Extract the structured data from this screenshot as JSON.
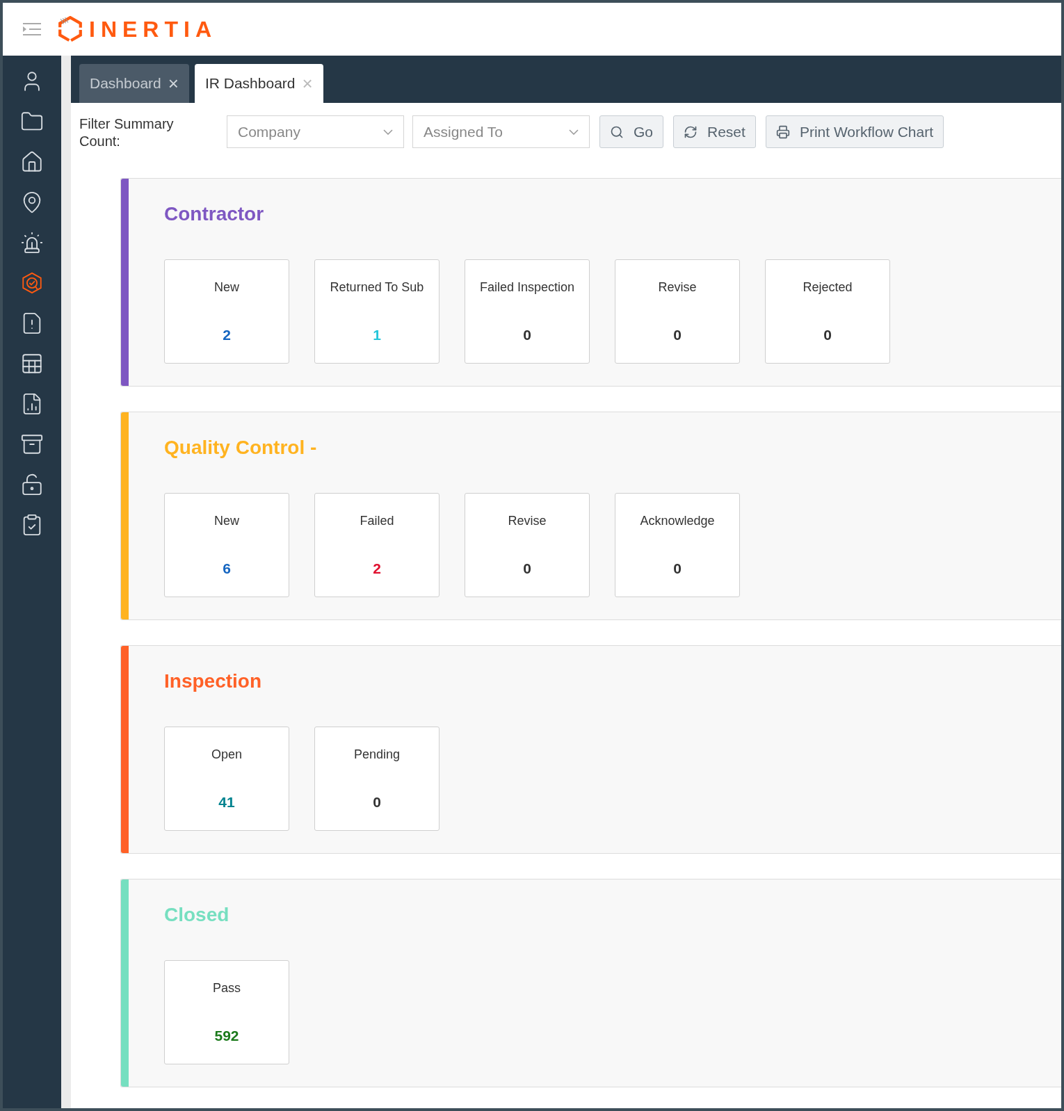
{
  "header": {
    "logo_text": "INERTIA"
  },
  "sidebar": {
    "items": [
      {
        "selected": false
      },
      {
        "selected": false
      },
      {
        "selected": false
      },
      {
        "selected": false
      },
      {
        "selected": false
      },
      {
        "selected": true
      },
      {
        "selected": false
      },
      {
        "selected": false
      },
      {
        "selected": false
      },
      {
        "selected": false
      },
      {
        "selected": false
      },
      {
        "selected": false
      }
    ]
  },
  "tabs": [
    {
      "label": "Dashboard",
      "selected": false,
      "close": "×"
    },
    {
      "label": "IR Dashboard",
      "selected": true,
      "close": "×"
    }
  ],
  "filter": {
    "label": "Filter Summary Count:",
    "company": {
      "placeholder": "Company"
    },
    "assigned_to": {
      "placeholder": "Assigned To"
    },
    "buttons": [
      {
        "kind": "search",
        "label": "Go"
      },
      {
        "kind": "reset",
        "label": "Reset"
      },
      {
        "kind": "print",
        "label": "Print Workflow Chart"
      }
    ]
  },
  "sections": [
    {
      "title": "Contractor",
      "color": "#7e57c2",
      "stats": [
        {
          "label": "New",
          "count": "2",
          "color": "#1565c0"
        },
        {
          "label": "Returned To Sub",
          "count": "1",
          "color": "#26c6da"
        },
        {
          "label": "Failed Inspection",
          "count": "0",
          "color": "#333333"
        },
        {
          "label": "Revise",
          "count": "0",
          "color": "#333333"
        },
        {
          "label": "Rejected",
          "count": "0",
          "color": "#333333"
        }
      ]
    },
    {
      "title": "Quality Control -",
      "color": "#ffb320",
      "stats": [
        {
          "label": "New",
          "count": "6",
          "color": "#1565c0"
        },
        {
          "label": "Failed",
          "count": "2",
          "color": "#e0102f"
        },
        {
          "label": "Revise",
          "count": "0",
          "color": "#333333"
        },
        {
          "label": "Acknowledge",
          "count": "0",
          "color": "#333333"
        }
      ]
    },
    {
      "title": "Inspection",
      "color": "#ff6127",
      "stats": [
        {
          "label": "Open",
          "count": "41",
          "color": "#00838f"
        },
        {
          "label": "Pending",
          "count": "0",
          "color": "#333333"
        }
      ]
    },
    {
      "title": "Closed",
      "color": "#76dfc0",
      "stats": [
        {
          "label": "Pass",
          "count": "592",
          "color": "#1b7a1b"
        }
      ]
    }
  ]
}
